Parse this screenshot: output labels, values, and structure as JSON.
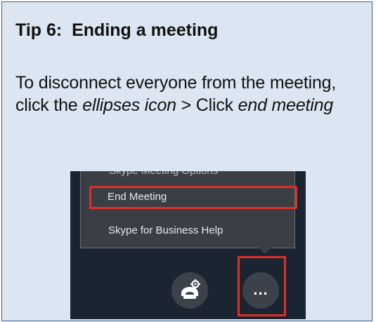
{
  "tip": {
    "title": "Tip 6:  Ending a meeting",
    "body_part1": "To disconnect everyone from the meeting, click the ",
    "body_em1": "ellipses icon",
    "body_part2": " > Click ",
    "body_em2": "end meeting"
  },
  "screenshot": {
    "menu": {
      "partial_item": "Skype Meeting Options",
      "end_meeting_label": "End Meeting",
      "help_label": "Skype for Business Help"
    },
    "buttons": {
      "phone_icon": "call-controls-icon",
      "more_label": "...",
      "more_icon": "ellipsis-icon"
    },
    "highlight_color": "#e02f24",
    "background_color": "#1b2532"
  },
  "colors": {
    "card_background": "#dce6f2",
    "card_border": "#3a5f8f"
  }
}
